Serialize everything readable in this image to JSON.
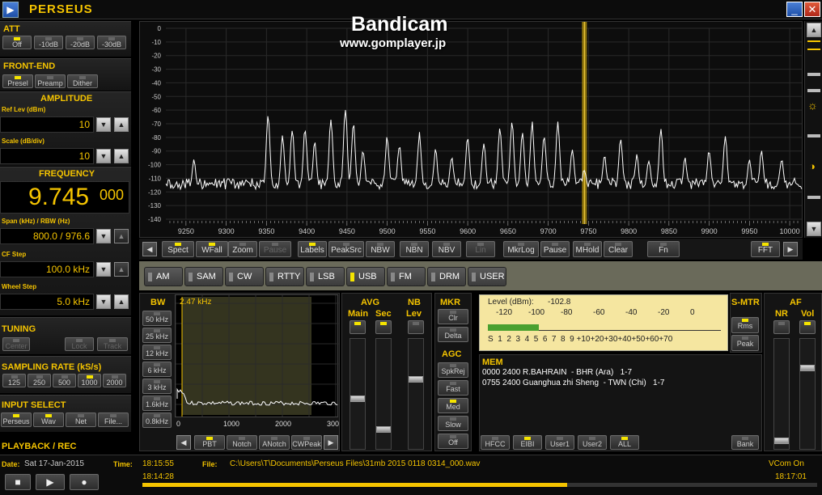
{
  "window": {
    "title": "PERSEUS",
    "app_icon": "▶",
    "minimize": "_",
    "close": "✕"
  },
  "watermark": {
    "line1": "Bandicam",
    "line2": "www.gomplayer.jp"
  },
  "att": {
    "label": "ATT",
    "buttons": [
      {
        "label": "Off",
        "on": true
      },
      {
        "label": "-10dB",
        "on": false
      },
      {
        "label": "-20dB",
        "on": false
      },
      {
        "label": "-30dB",
        "on": false
      }
    ]
  },
  "frontend": {
    "label": "FRONT-END",
    "buttons": [
      {
        "label": "Presel",
        "on": true
      },
      {
        "label": "Preamp",
        "on": false
      },
      {
        "label": "Dither",
        "on": false
      }
    ]
  },
  "amplitude": {
    "label": "AMPLITUDE",
    "ref_label": "Ref Lev (dBm)",
    "ref_value": "10",
    "scale_label": "Scale (dB/div)",
    "scale_value": "10"
  },
  "frequency": {
    "label": "FREQUENCY",
    "main": "9.745",
    "sub": "000",
    "span_label": "Span (kHz) / RBW (Hz)",
    "span_value": "800.0 / 976.6",
    "cfstep_label": "CF Step",
    "cfstep_value": "100.0 kHz",
    "wheel_label": "Wheel Step",
    "wheel_value": "5.0 kHz"
  },
  "tuning": {
    "label": "TUNING",
    "buttons": [
      "Center",
      "Lock",
      "Track"
    ]
  },
  "sampling": {
    "label": "SAMPLING RATE (kS/s)",
    "buttons": [
      {
        "label": "125",
        "on": false
      },
      {
        "label": "250",
        "on": false
      },
      {
        "label": "500",
        "on": false
      },
      {
        "label": "1000",
        "on": true
      },
      {
        "label": "2000",
        "on": false
      }
    ]
  },
  "input": {
    "label": "INPUT SELECT",
    "buttons": [
      {
        "label": "Perseus",
        "on": true
      },
      {
        "label": "Wav",
        "on": true
      },
      {
        "label": "Net",
        "on": false
      },
      {
        "label": "File...",
        "on": false
      }
    ]
  },
  "playback": {
    "label": "PLAYBACK / REC"
  },
  "spectrum": {
    "y_ticks": [
      "0",
      "-10",
      "-20",
      "-30",
      "-40",
      "-50",
      "-60",
      "-70",
      "-80",
      "-90",
      "-100",
      "-110",
      "-120",
      "-130",
      "-140"
    ],
    "x_ticks": [
      "9250",
      "9300",
      "9350",
      "9400",
      "9450",
      "9500",
      "9550",
      "9600",
      "9650",
      "9700",
      "9750",
      "9800",
      "9850",
      "9900",
      "9950",
      "10000"
    ],
    "tuned_khz": 9745,
    "x_min_khz": 9225,
    "x_max_khz": 10015
  },
  "toolbar": [
    {
      "label": "Spect",
      "on": true
    },
    {
      "label": "WFall",
      "on": true
    },
    {
      "label": "Zoom",
      "on": false
    },
    {
      "label": "Pause",
      "on": false,
      "dim": true
    },
    {
      "label": "Labels",
      "on": true
    },
    {
      "label": "PeakSrc",
      "on": false
    },
    {
      "label": "NBW",
      "on": false
    },
    {
      "label": "NBN",
      "on": false
    },
    {
      "label": "NBV",
      "on": false
    },
    {
      "label": "Lin",
      "on": false,
      "dim": true
    },
    {
      "label": "MkrLog",
      "on": false
    },
    {
      "label": "Pause",
      "on": false
    },
    {
      "label": "MHold",
      "on": false
    },
    {
      "label": "Clear",
      "on": false
    },
    {
      "label": "Fn",
      "on": false
    }
  ],
  "fft": "FFT",
  "modes": [
    {
      "label": "AM",
      "on": false
    },
    {
      "label": "SAM",
      "on": false
    },
    {
      "label": "CW",
      "on": false
    },
    {
      "label": "RTTY",
      "on": false
    },
    {
      "label": "LSB",
      "on": false
    },
    {
      "label": "USB",
      "on": true
    },
    {
      "label": "FM",
      "on": false
    },
    {
      "label": "DRM",
      "on": false
    },
    {
      "label": "USER",
      "on": false
    }
  ],
  "bw": {
    "label": "BW",
    "buttons": [
      "50 kHz",
      "25 kHz",
      "12 kHz",
      "6 kHz",
      "3 kHz",
      "1.6kHz",
      "0.8kHz"
    ],
    "current": "2.47 kHz",
    "x_ticks": [
      "0",
      "1000",
      "2000",
      "300"
    ]
  },
  "filters": [
    {
      "label": "PBT",
      "on": true
    },
    {
      "label": "Notch",
      "on": false
    },
    {
      "label": "ANotch",
      "on": false
    },
    {
      "label": "CWPeak",
      "on": false
    }
  ],
  "avg": {
    "label": "AVG",
    "main": "Main",
    "sec": "Sec"
  },
  "nb": {
    "label": "NB",
    "lev": "Lev"
  },
  "mkr": {
    "label": "MKR",
    "buttons": [
      "Clr",
      "Delta"
    ]
  },
  "agc": {
    "label": "AGC",
    "buttons": [
      "SpkRej",
      "Fast",
      "Med",
      "Slow",
      "Off"
    ]
  },
  "level": {
    "label": "Level (dBm):",
    "value": "-102.8",
    "top_scale": [
      "-120",
      "-100",
      "-80",
      "-60",
      "-40",
      "-20",
      "0"
    ],
    "bottom_scale": "S  1  2  3  4  5  6  7  8  9 +10+20+30+40+50+60+70",
    "bar_fraction": 0.22
  },
  "smtr": {
    "label": "S-MTR",
    "buttons": [
      "Rms",
      "Peak"
    ]
  },
  "af": {
    "label": "AF",
    "nr": "NR",
    "vol": "Vol"
  },
  "mem": {
    "label": "MEM",
    "items": [
      "0000 2400 R.BAHRAIN  - BHR (Ara)   1-7",
      "0755 2400 Guanghua zhi Sheng  - TWN (Chi)   1-7"
    ],
    "buttons": [
      "HFCC",
      "EIBI",
      "User1",
      "User2",
      "ALL"
    ],
    "bank": "Bank"
  },
  "status": {
    "date_label": "Date:",
    "date": "Sat 17-Jan-2015",
    "time_label": "Time:",
    "time": "18:15:55",
    "file_label": "File:",
    "file": "C:\\Users\\T\\Documents\\Perseus Files\\31mb 2015 0118 0314_000.wav",
    "vcom": "VCom On",
    "start": "18:14:28",
    "end": "18:17:01",
    "progress": 0.63
  }
}
